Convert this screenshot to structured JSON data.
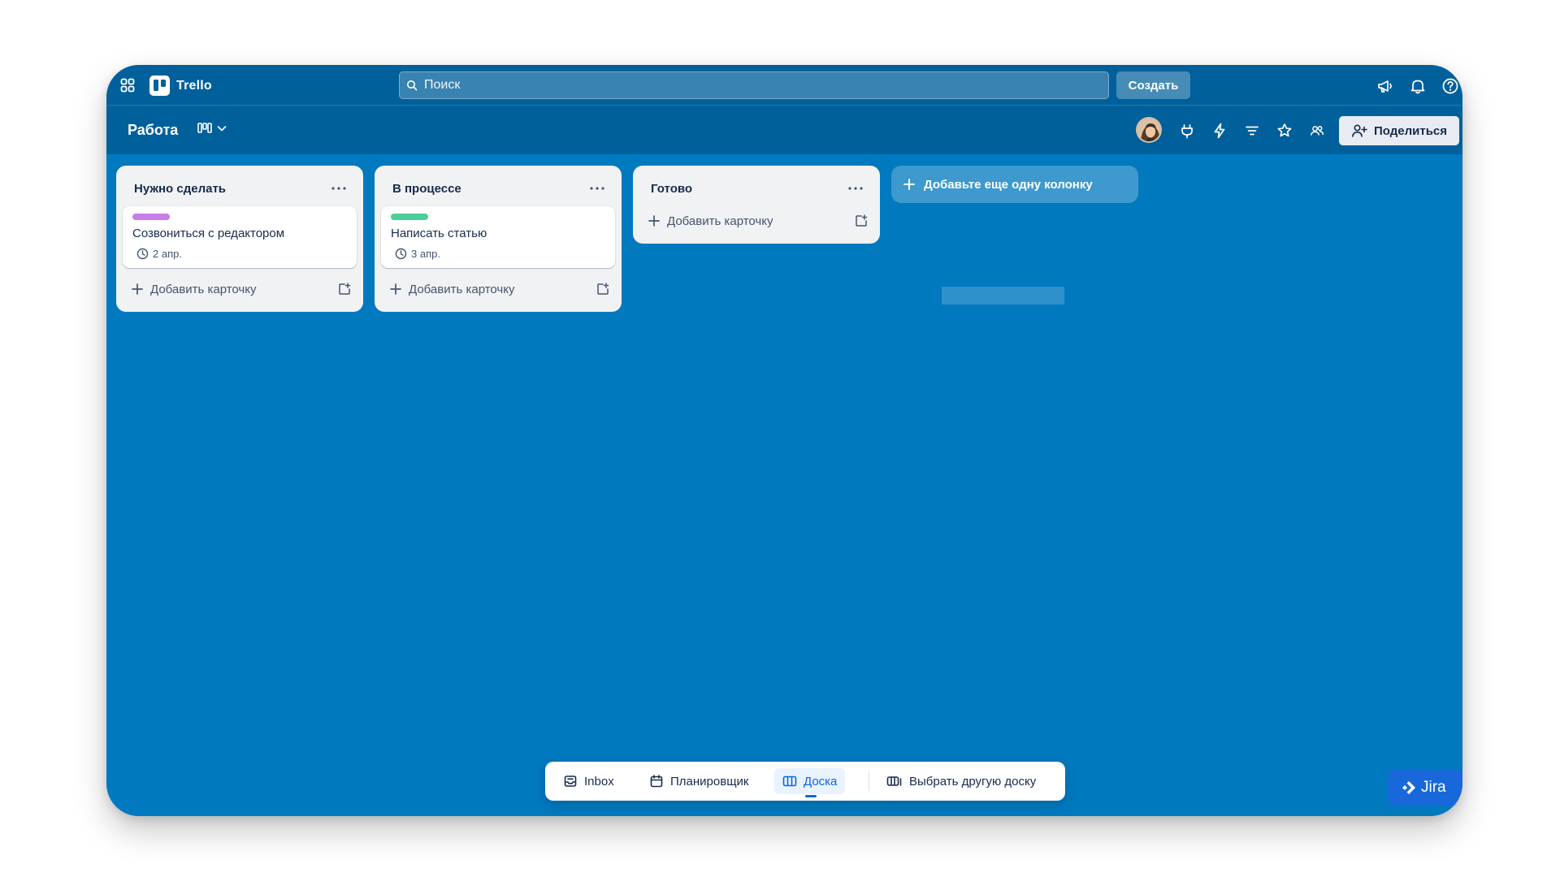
{
  "app": {
    "name": "Trello"
  },
  "topbar": {
    "search_placeholder": "Поиск",
    "create_label": "Создать",
    "icons": [
      "apps-grid-icon",
      "megaphone-icon",
      "bell-icon",
      "help-icon"
    ]
  },
  "board": {
    "title": "Работа",
    "share_label": "Поделиться",
    "header_icons": [
      "power-ups-icon",
      "automation-icon",
      "filter-icon",
      "star-icon",
      "members-icon"
    ]
  },
  "lists": [
    {
      "title": "Нужно сделать",
      "cards": [
        {
          "label_color": "#c77ce8",
          "title": "Созвониться с редактором",
          "date": "2 апр."
        }
      ],
      "add_card_label": "Добавить карточку"
    },
    {
      "title": "В процессе",
      "cards": [
        {
          "label_color": "#4bce97",
          "title": "Написать статью",
          "date": "3 апр."
        }
      ],
      "add_card_label": "Добавить карточку"
    },
    {
      "title": "Готово",
      "cards": [],
      "add_card_label": "Добавить карточку"
    }
  ],
  "add_list_label": "Добавьте еще одну колонку",
  "switcher": {
    "items": [
      {
        "label": "Inbox",
        "icon": "inbox-icon",
        "active": false
      },
      {
        "label": "Планировщик",
        "icon": "calendar-icon",
        "active": false
      },
      {
        "label": "Доска",
        "icon": "board-icon",
        "active": true
      },
      {
        "label": "Выбрать другую доску",
        "icon": "switch-board-icon",
        "active": false
      }
    ]
  },
  "jira_label": "Jira",
  "colors": {
    "board_background": "#0079bf",
    "header_background": "#00609b",
    "list_background": "#f1f2f4",
    "accent": "#0c66e4"
  }
}
